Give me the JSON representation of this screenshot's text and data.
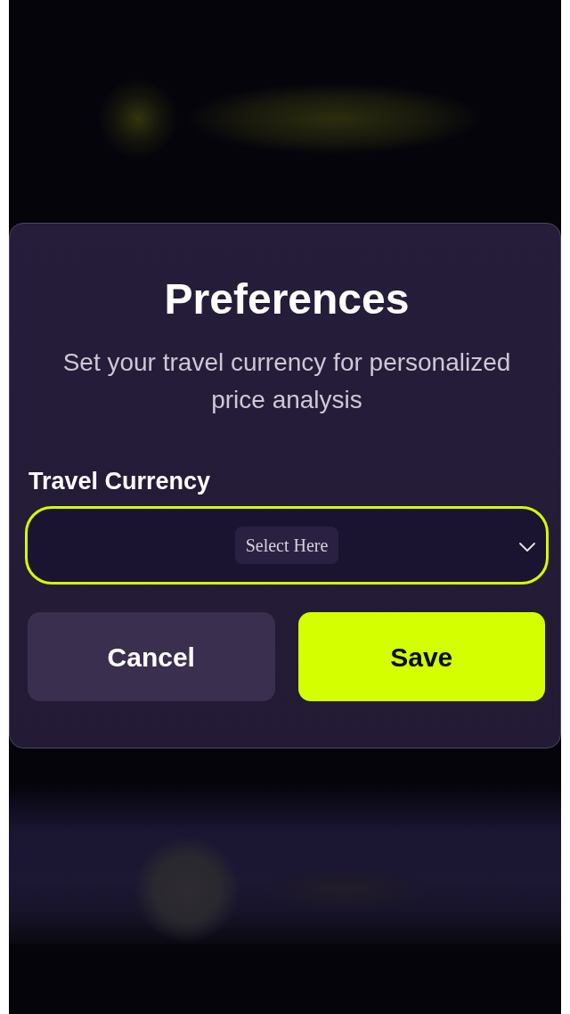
{
  "dialog": {
    "title": "Preferences",
    "subtitle": "Set your travel currency for personalized price analysis",
    "field": {
      "label": "Travel Currency",
      "placeholder": "Select Here",
      "focused": true
    },
    "buttons": [
      {
        "label": "Cancel",
        "kind": "secondary"
      },
      {
        "label": "Save",
        "kind": "primary"
      }
    ]
  }
}
